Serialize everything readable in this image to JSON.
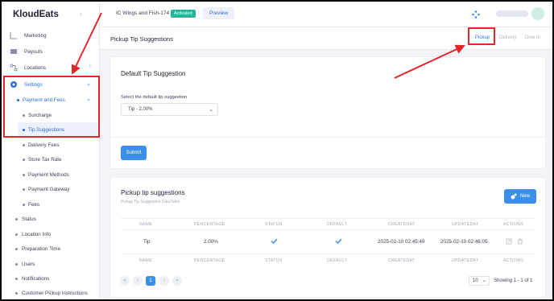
{
  "brand": {
    "name": "KloudEats"
  },
  "sidebar": {
    "items": [
      {
        "label": "Marketing"
      },
      {
        "label": "Payouts"
      },
      {
        "label": "Locations"
      },
      {
        "label": "Settings"
      },
      {
        "label": "Payment and Fees"
      },
      {
        "label": "Surcharge"
      },
      {
        "label": "Tip Suggestions"
      },
      {
        "label": "Delivery Fees"
      },
      {
        "label": "Store Tax Rate"
      },
      {
        "label": "Payment Methods"
      },
      {
        "label": "Payment Gateway"
      },
      {
        "label": "Fees"
      },
      {
        "label": "Status"
      },
      {
        "label": "Location Info"
      },
      {
        "label": "Preparation Time"
      },
      {
        "label": "Users"
      },
      {
        "label": "Notifications"
      },
      {
        "label": "Customer Pickup Instructions"
      }
    ]
  },
  "topbar": {
    "store": "IC Wings and Fish-174",
    "status_badge": "Activated",
    "preview": "Preview"
  },
  "header": {
    "title": "Pickup Tip Suggestions",
    "tabs": [
      {
        "label": "Pickup"
      },
      {
        "label": "Delivery"
      },
      {
        "label": "Dine In"
      }
    ]
  },
  "default_card": {
    "title": "Default Tip Suggestion",
    "select_label": "Select the default tip suggestion",
    "select_value": "Tip - 2.00%",
    "submit": "Submit"
  },
  "table_card": {
    "title": "Pickup tip suggestions",
    "subtitle": "Pickup Tip Suggestion DataTable",
    "new_button": "New",
    "columns": [
      "NAME",
      "PERCENTAGE",
      "STATUS",
      "DEFAULT",
      "CREATEDAT",
      "UPDATEDAT",
      "ACTIONS"
    ],
    "rows": [
      {
        "name": "Tip",
        "percentage": "2.00%",
        "status": true,
        "default": true,
        "createdat": "2025-02-10 02:45:49",
        "updatedat": "2025-02-10 02:46:05"
      }
    ],
    "pagination": {
      "first": "«",
      "prev": "‹",
      "current": "1",
      "next": "›",
      "last": "»"
    },
    "page_size": "10",
    "showing": "Showing 1 - 1 of 1"
  },
  "colors": {
    "accent": "#3a8fe8",
    "annotation": "#e3262c",
    "badge": "#27b59a"
  }
}
